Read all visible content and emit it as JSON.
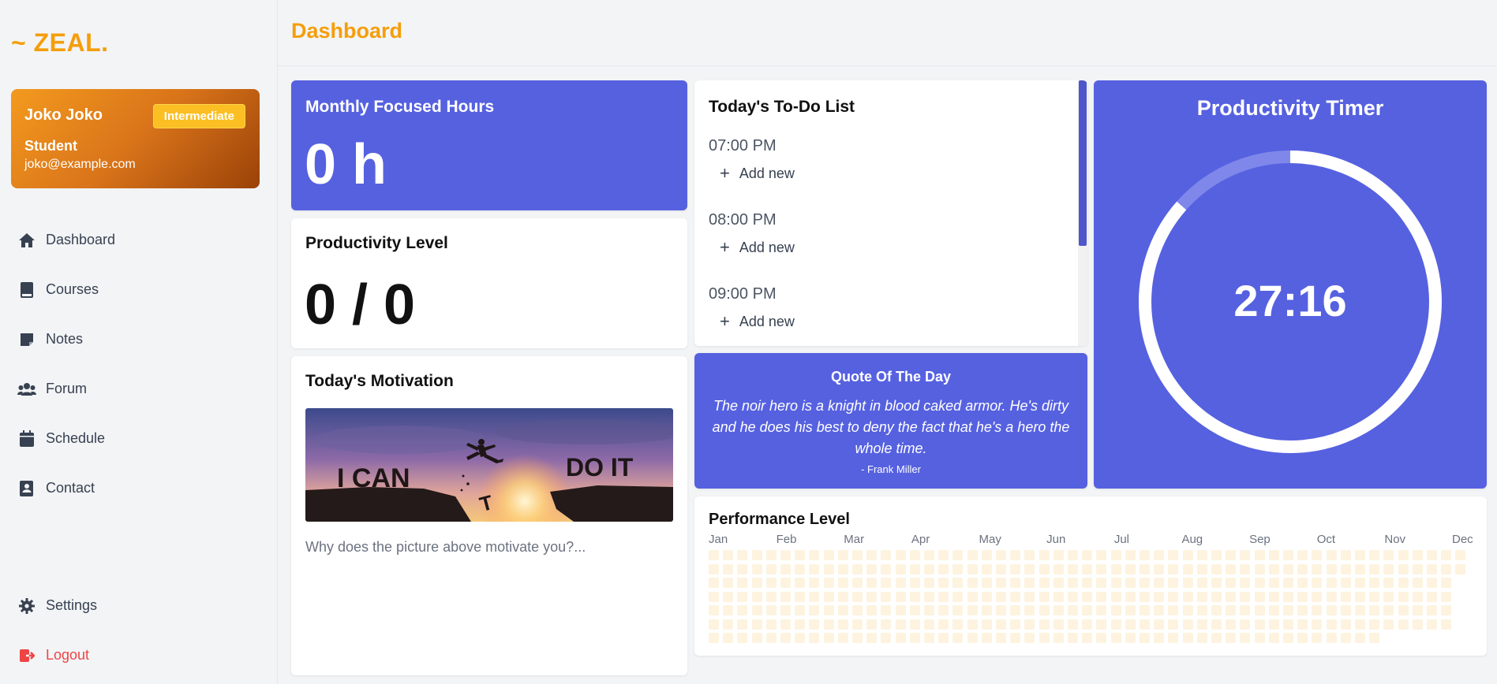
{
  "brand": {
    "logo": "~ ZEAL."
  },
  "profile": {
    "name": "Joko Joko",
    "badge": "Intermediate",
    "role": "Student",
    "email": "joko@example.com"
  },
  "nav": {
    "items": [
      {
        "label": "Dashboard",
        "icon": "home-icon"
      },
      {
        "label": "Courses",
        "icon": "book-icon"
      },
      {
        "label": "Notes",
        "icon": "note-icon"
      },
      {
        "label": "Forum",
        "icon": "users-icon"
      },
      {
        "label": "Schedule",
        "icon": "calendar-icon"
      },
      {
        "label": "Contact",
        "icon": "contact-icon"
      }
    ],
    "settings": "Settings",
    "logout": "Logout"
  },
  "header": {
    "title": "Dashboard"
  },
  "monthly": {
    "title": "Monthly Focused Hours",
    "value": "0 h"
  },
  "level": {
    "title": "Productivity Level",
    "value": "0 / 0"
  },
  "motivation": {
    "title": "Today's Motivation",
    "prompt": "Why does the picture above motivate you?...",
    "image_words": [
      "I CAN",
      "T",
      "DO IT"
    ]
  },
  "todo": {
    "title": "Today's To-Do List",
    "slots": [
      {
        "time": "07:00 PM",
        "add": "Add new"
      },
      {
        "time": "08:00 PM",
        "add": "Add new"
      },
      {
        "time": "09:00 PM",
        "add": "Add new"
      }
    ]
  },
  "quote": {
    "title": "Quote Of The Day",
    "text": "The noir hero is a knight in blood caked armor. He's dirty and he does his best to deny the fact that he's a hero the whole time.",
    "author": "- Frank Miller"
  },
  "timer": {
    "title": "Productivity Timer",
    "time": "27:16",
    "progress": 0.865
  },
  "performance": {
    "title": "Performance Level",
    "months": [
      "Jan",
      "Feb",
      "Mar",
      "Apr",
      "May",
      "Jun",
      "Jul",
      "Aug",
      "Sep",
      "Oct",
      "Nov",
      "Dec"
    ]
  },
  "colors": {
    "accent": "#f59e0b",
    "primary": "#5661e0",
    "danger": "#ef4444",
    "heat_empty": "#fdf3df"
  }
}
